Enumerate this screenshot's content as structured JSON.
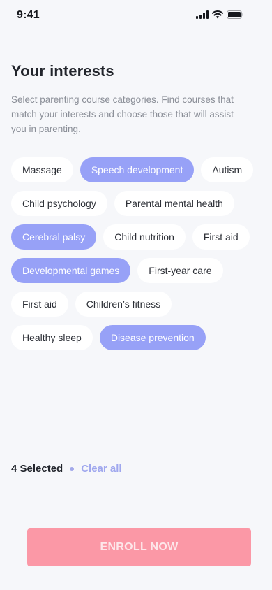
{
  "status_bar": {
    "time": "9:41",
    "icons": [
      "cellular-signal-icon",
      "wifi-icon",
      "battery-icon"
    ]
  },
  "header": {
    "title": "Your interests",
    "subtitle": "Select parenting course categories. Find courses that match your interests and choose those that will assist you in parenting."
  },
  "chips": [
    {
      "label": "Massage",
      "selected": false
    },
    {
      "label": "Speech development",
      "selected": true
    },
    {
      "label": "Autism",
      "selected": false
    },
    {
      "label": "Child psychology",
      "selected": false
    },
    {
      "label": "Parental mental health",
      "selected": false
    },
    {
      "label": "Cerebral palsy",
      "selected": true
    },
    {
      "label": "Child nutrition",
      "selected": false
    },
    {
      "label": "First aid",
      "selected": false
    },
    {
      "label": "Developmental games",
      "selected": true
    },
    {
      "label": "First-year care",
      "selected": false
    },
    {
      "label": "First aid",
      "selected": false
    },
    {
      "label": "Children’s fitness",
      "selected": false
    },
    {
      "label": "Healthy sleep",
      "selected": false
    },
    {
      "label": "Disease prevention",
      "selected": true
    }
  ],
  "selection": {
    "count_label": "4 Selected",
    "clear_label": "Clear all"
  },
  "footer": {
    "enroll_label": "ENROLL NOW"
  },
  "colors": {
    "accent_chip": "#97a1f7",
    "enroll_button": "#fb98a6",
    "background": "#f6f7fa"
  }
}
